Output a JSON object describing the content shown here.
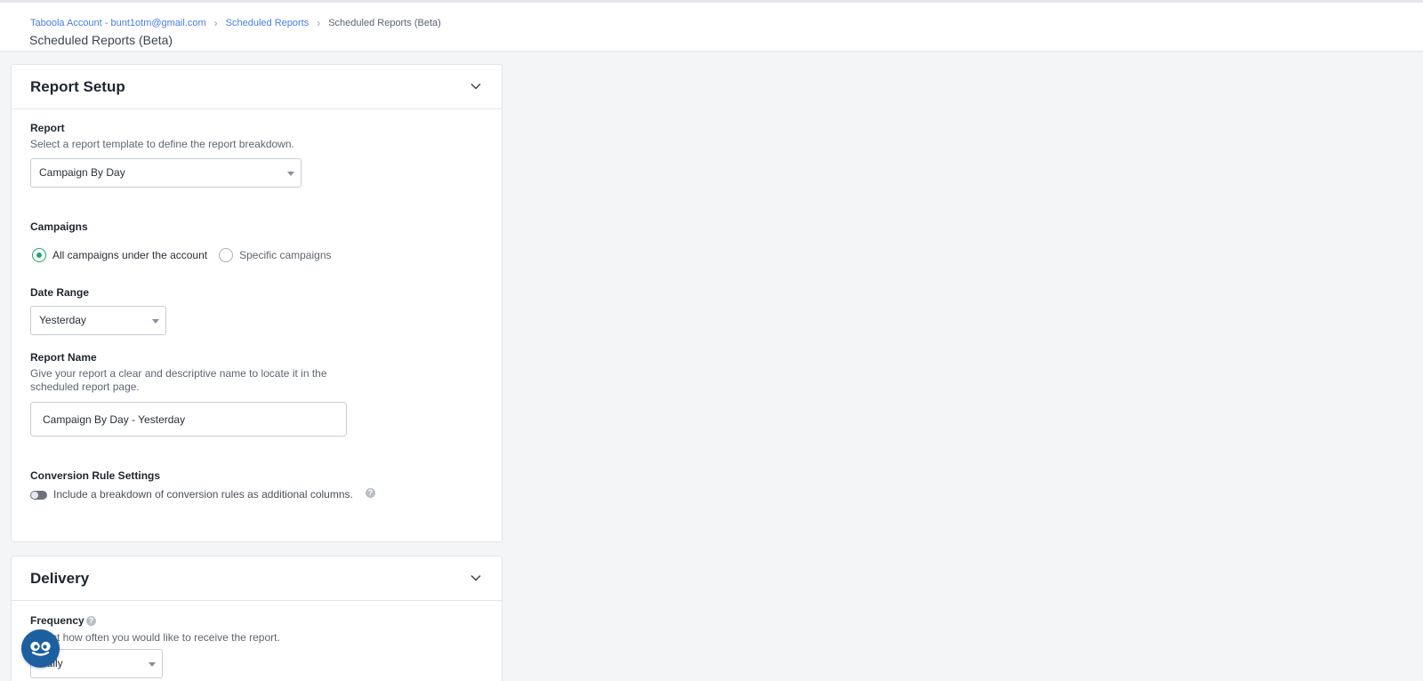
{
  "breadcrumb": {
    "account": "Taboola Account - bunt1otm@gmail.com",
    "reports": "Scheduled Reports",
    "current": "Scheduled Reports (Beta)"
  },
  "page": {
    "title": "Scheduled Reports (Beta)"
  },
  "report_setup": {
    "title": "Report Setup",
    "report": {
      "label": "Report",
      "description": "Select a report template to define the report breakdown.",
      "selected": "Campaign By Day"
    },
    "campaigns": {
      "label": "Campaigns",
      "options": [
        {
          "label": "All campaigns under the account",
          "checked": true
        },
        {
          "label": "Specific campaigns",
          "checked": false
        }
      ]
    },
    "date_range": {
      "label": "Date Range",
      "selected": "Yesterday"
    },
    "report_name": {
      "label": "Report Name",
      "description_line1": "Give your report a clear and descriptive name to locate it in the",
      "description_line2": "scheduled report page.",
      "value": "Campaign By Day - Yesterday"
    },
    "conversion": {
      "label": "Conversion Rule Settings",
      "toggle_text": "Include a breakdown of conversion rules as additional columns.",
      "enabled": false
    }
  },
  "delivery": {
    "title": "Delivery",
    "frequency": {
      "label": "Frequency",
      "description": "Select how often you would like to receive the report.",
      "selected": "Daily"
    }
  },
  "colors": {
    "accent_link": "#4a7fe0",
    "radio_checked": "#23a66b",
    "chat_button": "#1b5fa0"
  }
}
